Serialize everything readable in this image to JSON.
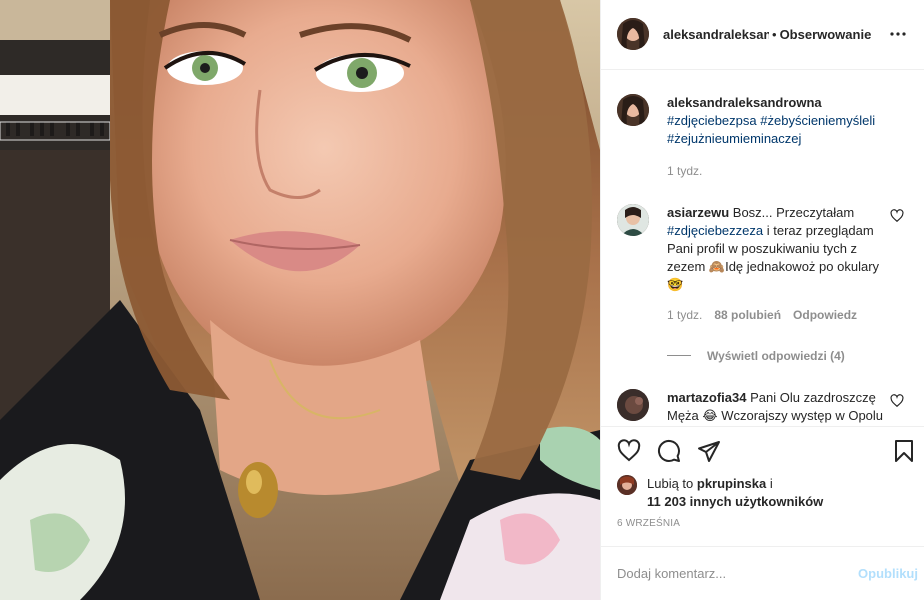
{
  "header": {
    "username": "aleksandraleksandrowna",
    "separator": "•",
    "follow_label": "Obserwowanie",
    "more_icon": "ellipsis-icon"
  },
  "caption": {
    "username": "aleksandraleksandrowna",
    "hashtags": [
      "#zdjęciebezpsa",
      "#żebyścieniemyśleli",
      "#żejużnieumieminaczej"
    ],
    "time": "1 tydz."
  },
  "comments": [
    {
      "username": "asiarzewu",
      "text_before": "Bosz... Przeczytałam",
      "hashtag": "#zdjęciebezzeza",
      "text_after": "i teraz przeglądam Pani profil w poszukiwaniu tych z zezem 🙈Idę jednakowoż po okulary 🤓",
      "time": "1 tydz.",
      "likes": "88 polubień",
      "reply_label": "Odpowiedz",
      "view_replies": "Wyświetl odpowiedzi (4)"
    },
    {
      "username": "martazofia34",
      "text": "Pani Olu zazdroszczę Męża 😂 Wczorajszy występ w Opolu : fantastyczny👌"
    }
  ],
  "actions": {
    "like_icon": "heart-icon",
    "comment_icon": "comment-icon",
    "share_icon": "paper-plane-icon",
    "save_icon": "bookmark-icon"
  },
  "likes": {
    "prefix": "Lubią to",
    "user": "pkrupinska",
    "connector": "i",
    "others": "11 203 innych użytkowników"
  },
  "date": "6 WRZEŚNIA",
  "add_comment": {
    "placeholder": "Dodaj komentarz...",
    "post_label": "Opublikuj"
  },
  "colors": {
    "link": "#00376b",
    "muted": "#8e8e8e",
    "post_disabled": "#b2dffc"
  }
}
